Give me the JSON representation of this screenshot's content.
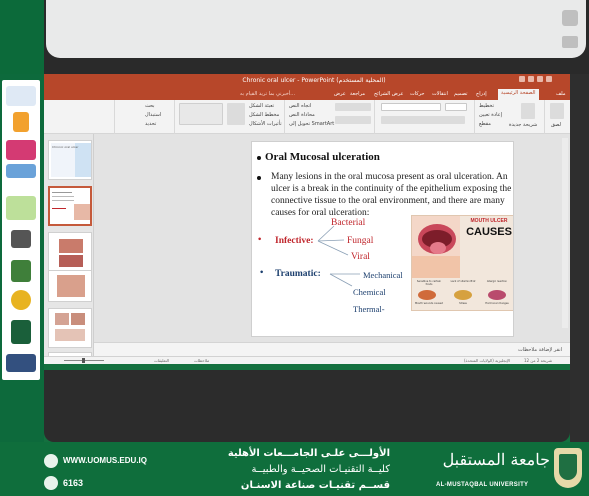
{
  "window": {
    "title": "Chronic oral ulcer - PowerPoint (المحلية المستخدم)",
    "tabs": [
      "ملف",
      "الصفحة الرئيسية",
      "إدراج",
      "تصميم",
      "انتقالات",
      "حركات",
      "عرض الشرائح",
      "مراجعة",
      "عرض",
      "أخبرني بما تريد القيام به..."
    ],
    "active_tab": "الصفحة الرئيسية"
  },
  "ribbon": {
    "groups": [
      "الحافظة",
      "شرائح",
      "خط",
      "فقرة",
      "رسم",
      "تحرير"
    ],
    "labels": [
      "لصق",
      "شريحة جديدة",
      "تخطيط",
      "إعادة تعيين",
      "مقطع",
      "اتجاه النص",
      "محاذاة النص",
      "تحويل إلى SmartArt",
      "تعبئة الشكل",
      "مخطط الشكل",
      "تأثيرات الأشكال",
      "بحث",
      "استبدال",
      "تحديد"
    ]
  },
  "thumbnails": {
    "count": 6,
    "selected": 2,
    "first_caption": "Chronic oral ulcer"
  },
  "slide": {
    "title": "Oral Mucosal ulceration",
    "paragraph": "Many lesions in the oral mucosa present as oral ulceration. An ulcer is a break in the continuity of the epithelium exposing the connective tissue to the oral environment, and there are many causes for oral ulceration:",
    "infective_label": "Infective:",
    "infective_items": [
      "Bacterial",
      "Fungal",
      "Viral"
    ],
    "traumatic_label": "Traumatic:",
    "traumatic_items": [
      "Mechanical",
      "Chemical",
      "Thermal-"
    ],
    "image": {
      "header": "MOUTH ULCER",
      "big_text": "CAUSES",
      "caption_items": [
        "Sensitive to certain foods",
        "Lack of vitamin B12",
        "Allergic reaction",
        "Mouth wounds caused",
        "Stress",
        "Hormonal changes"
      ]
    }
  },
  "notes_placeholder": "انقر لإضافة ملاحظات",
  "statusbar": {
    "slide_info": "شريحة 2 من 12",
    "language": "الإنجليزية (الولايات المتحدة)",
    "notes_btn": "ملاحظات",
    "comments_btn": "التعليقات"
  },
  "banner": {
    "website": "WWW.UOMUS.EDU.IQ",
    "phone": "6163",
    "line1": "الأولـــى علـى الجامـــعات الأهلية",
    "line2": "كليــة التقنيـات الصحيــة والطبيــة",
    "line3": "قســم تقنيـات صناعة الاسنـان",
    "university_ar": "جامعة المستقبل",
    "university_en": "AL-MUSTAQBAL UNIVERSITY"
  },
  "colors": {
    "ppt_accent": "#b7472a",
    "green": "#0f6e3c",
    "infective": "#c0262c",
    "traumatic": "#1c3f6e"
  }
}
